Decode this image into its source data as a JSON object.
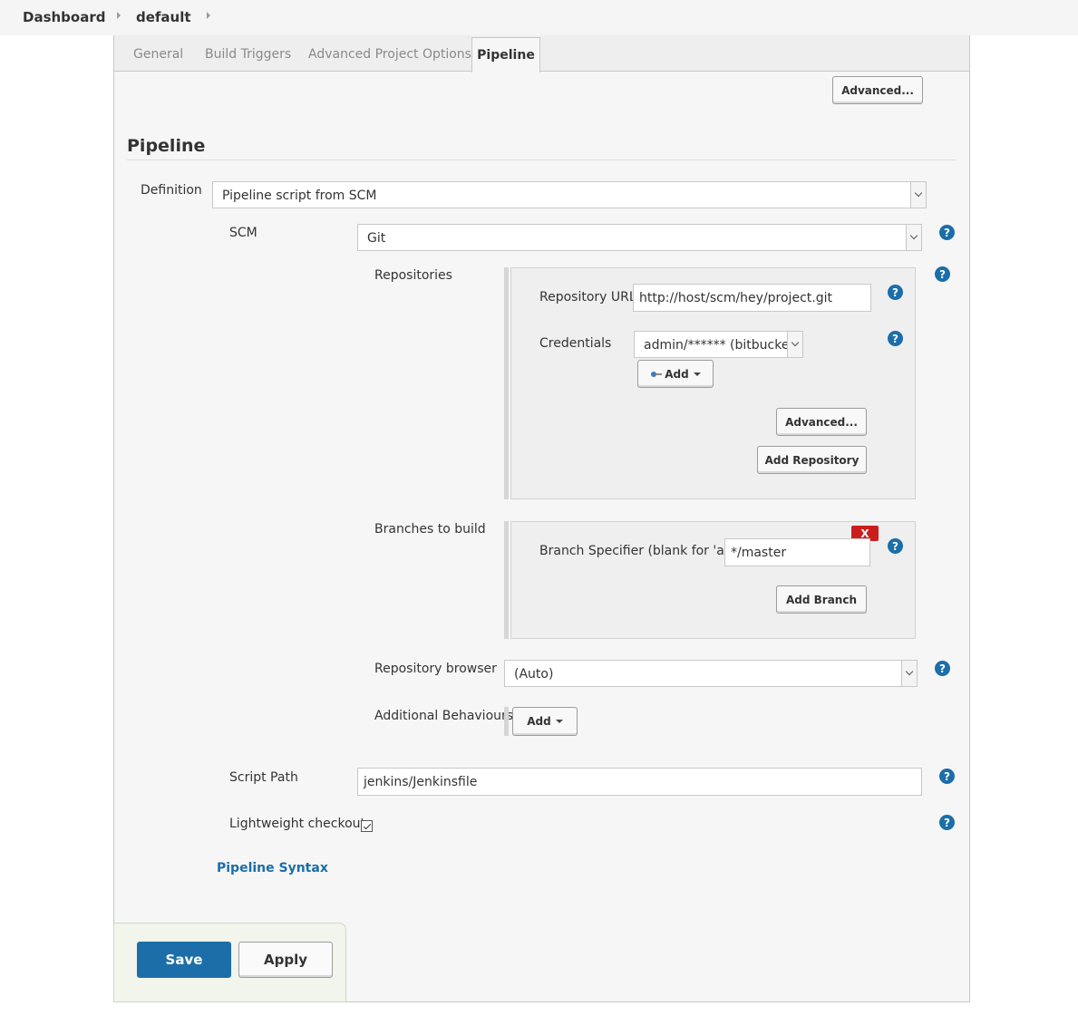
{
  "breadcrumb": {
    "items": [
      "Dashboard",
      "default"
    ]
  },
  "tabs": {
    "general": "General",
    "build_triggers": "Build Triggers",
    "advanced_project_options": "Advanced Project Options",
    "pipeline": "Pipeline"
  },
  "top_advanced_label": "Advanced...",
  "section": {
    "title": "Pipeline"
  },
  "definition": {
    "label": "Definition",
    "value": "Pipeline script from SCM"
  },
  "scm": {
    "label": "SCM",
    "value": "Git"
  },
  "repositories": {
    "label": "Repositories",
    "url_label": "Repository URL",
    "url_value": "http://host/scm/hey/project.git",
    "credentials_label": "Credentials",
    "credentials_value": "admin/****** (bitbucket)",
    "add_label": "Add",
    "advanced_label": "Advanced...",
    "add_repository_label": "Add Repository"
  },
  "branches": {
    "label": "Branches to build",
    "specifier_label": "Branch Specifier (blank for 'any')",
    "specifier_value": "*/master",
    "delete_label": "X",
    "add_branch_label": "Add Branch"
  },
  "repo_browser": {
    "label": "Repository browser",
    "value": "(Auto)"
  },
  "additional_behaviours": {
    "label": "Additional Behaviours",
    "add_label": "Add"
  },
  "script_path": {
    "label": "Script Path",
    "value": "jenkins/Jenkinsfile"
  },
  "lightweight": {
    "label": "Lightweight checkout",
    "checked": true
  },
  "help_glyph": "?",
  "pipeline_syntax_label": "Pipeline Syntax",
  "footer": {
    "save_label": "Save",
    "apply_label": "Apply"
  },
  "colors": {
    "primary": "#1b6ea8",
    "delete": "#cc1d1d"
  },
  "icons": {
    "credential_add": "key-icon"
  }
}
